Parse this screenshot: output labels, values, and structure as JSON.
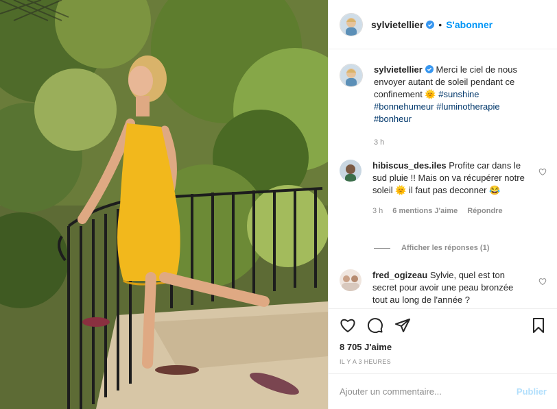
{
  "post": {
    "username": "sylvietellier",
    "follow_label": "S'abonner",
    "dot": "•",
    "caption_text": "Merci le ciel de nous envoyer autant de soleil pendant ce confinement 🌞",
    "hashtags": [
      "#sunshine",
      "#bonnehumeur",
      "#luminotherapie",
      "#bonheur"
    ],
    "caption_time": "3 h"
  },
  "comments": [
    {
      "username": "hibiscus_des.iles",
      "text": "Profite car dans le sud pluie !! Mais on va récupérer notre soleil 🌞 il faut pas deconner 😂",
      "time": "3 h",
      "likes": "6 mentions J'aime",
      "reply_label": "Répondre"
    },
    {
      "username": "fred_ogizeau",
      "text": "Sylvie, quel est ton secret pour avoir une peau bronzée tout au long de l'année ?"
    }
  ],
  "view_replies_label": "Afficher les réponses (1)",
  "likes_count": "8 705 J'aime",
  "timestamp": "IL Y A 3 HEURES",
  "add_comment": {
    "placeholder": "Ajouter un commentaire...",
    "publish_label": "Publier"
  },
  "colors": {
    "accent": "#0095f6",
    "hashtag": "#00376b",
    "muted": "#8e8e8e",
    "publish_disabled": "#b2dffc",
    "dress": "#f2b81c"
  },
  "icons": [
    "verified-badge-icon",
    "heart-icon",
    "comment-icon",
    "share-icon",
    "bookmark-icon"
  ]
}
